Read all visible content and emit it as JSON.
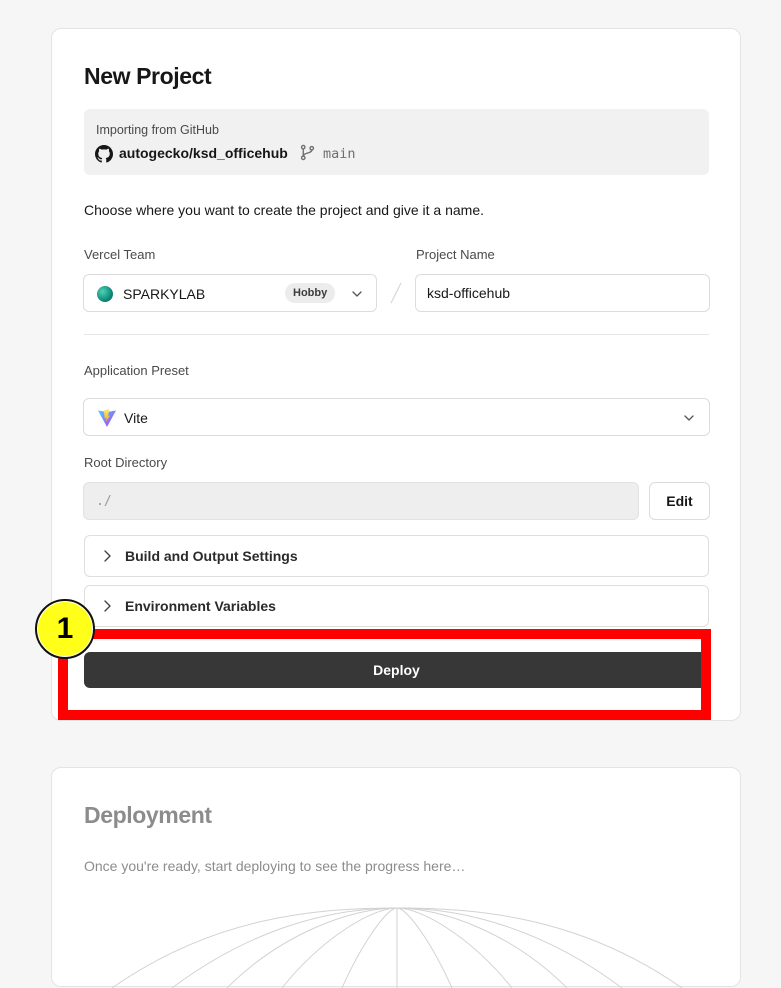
{
  "new_project": {
    "title": "New Project",
    "import": {
      "label": "Importing from GitHub",
      "repo": "autogecko/ksd_officehub",
      "branch": "main"
    },
    "description": "Choose where you want to create the project and give it a name.",
    "team": {
      "label": "Vercel Team",
      "name": "SPARKYLAB",
      "plan_badge": "Hobby"
    },
    "project_name": {
      "label": "Project Name",
      "value": "ksd-officehub"
    },
    "preset": {
      "label": "Application Preset",
      "value": "Vite"
    },
    "root_directory": {
      "label": "Root Directory",
      "value": "./",
      "edit_label": "Edit"
    },
    "accordions": [
      {
        "label": "Build and Output Settings"
      },
      {
        "label": "Environment Variables"
      }
    ],
    "deploy_label": "Deploy"
  },
  "annotation": {
    "marker_number": "1",
    "highlight_color": "#ff0000",
    "marker_color": "#ffff1a"
  },
  "deployment": {
    "title": "Deployment",
    "description": "Once you're ready, start deploying to see the progress here…"
  },
  "icons": {
    "repo": "github-icon",
    "branch": "git-branch-icon",
    "team": "team-avatar-icon",
    "preset": "vite-icon",
    "dropdown": "chevron-down-icon",
    "accordion": "chevron-right-icon"
  },
  "colors": {
    "deploy_button": "#373737",
    "page_background": "#f6f6f6"
  }
}
